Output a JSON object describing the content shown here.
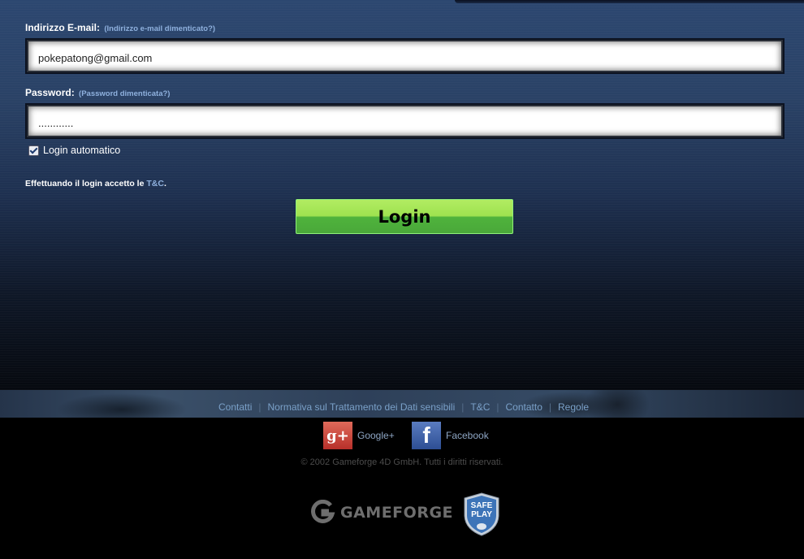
{
  "form": {
    "email_label": "Indirizzo E-mail:",
    "email_hint": "(Indirizzo e-mail dimenticato?)",
    "email_value": "pokepatong@gmail.com",
    "password_label": "Password:",
    "password_hint": "(Password dimenticata?)",
    "password_value": "............",
    "auto_login_label": "Login automatico",
    "auto_login_checked": true,
    "terms_text": "Effettuando il login accetto le",
    "terms_link": "T&C",
    "terms_suffix": ".",
    "login_label": "Login"
  },
  "footer": {
    "links": [
      "Contatti",
      "Normativa sul Trattamento dei Dati sensibili",
      "T&C",
      "Contatto",
      "Regole"
    ],
    "social": [
      {
        "label": "Google+",
        "icon": "google-plus-icon"
      },
      {
        "label": "Facebook",
        "icon": "facebook-icon"
      }
    ],
    "copyright": "© 2002 Gameforge 4D GmbH. Tutti i diritti riservati.",
    "brand": "GAMEFORGE",
    "badge_line1": "SAFE",
    "badge_line2": "PLAY"
  },
  "colors": {
    "accent_link": "#8fb1de",
    "login_green": "#9ee24f"
  }
}
